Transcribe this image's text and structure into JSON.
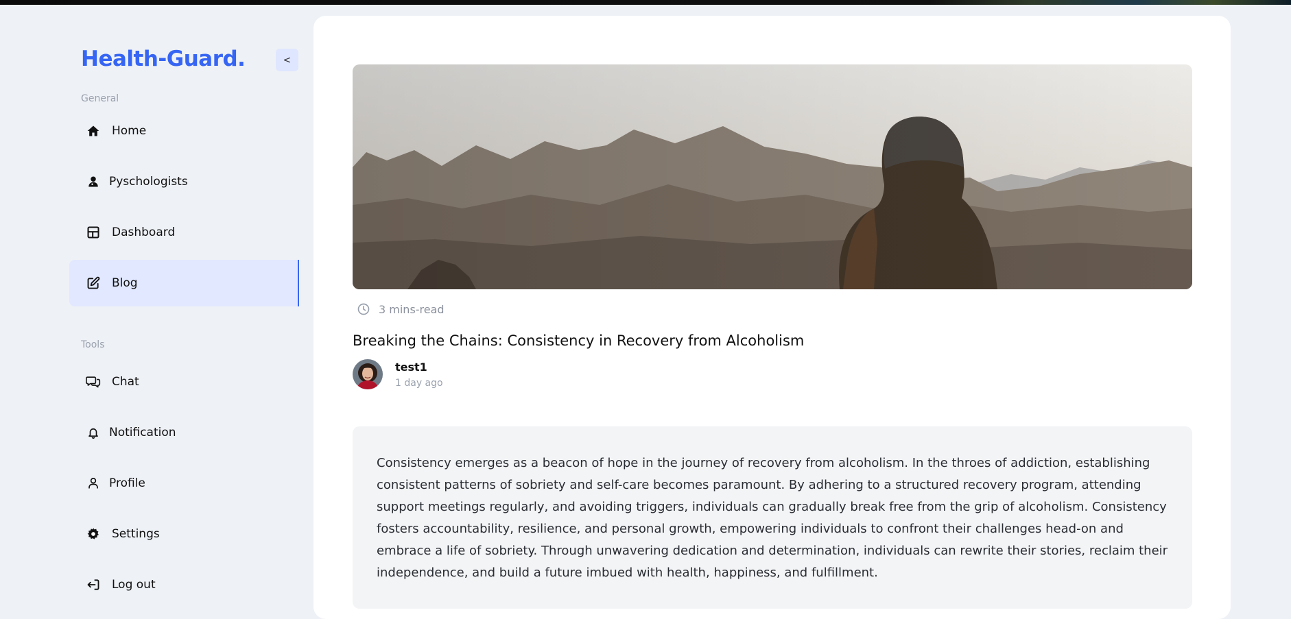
{
  "app": {
    "logo": "Health-Guard.",
    "collapse_label": "<"
  },
  "sidebar": {
    "general_label": "General",
    "tools_label": "Tools",
    "general_items": [
      {
        "label": "Home",
        "icon": "home-icon"
      },
      {
        "label": "Pyschologists",
        "icon": "psychologist-icon"
      },
      {
        "label": "Dashboard",
        "icon": "dashboard-icon"
      },
      {
        "label": "Blog",
        "icon": "edit-icon",
        "active": true
      }
    ],
    "tool_items": [
      {
        "label": "Chat",
        "icon": "chat-icon"
      },
      {
        "label": "Notification",
        "icon": "bell-icon"
      },
      {
        "label": "Profile",
        "icon": "user-icon"
      },
      {
        "label": "Settings",
        "icon": "gear-icon"
      },
      {
        "label": "Log out",
        "icon": "logout-icon"
      }
    ]
  },
  "post": {
    "read_time": "3 mins-read",
    "title": "Breaking the Chains: Consistency in Recovery from Alcoholism",
    "author": "test1",
    "posted": "1 day ago",
    "body": "Consistency emerges as a beacon of hope in the journey of recovery from alcoholism. In the throes of addiction, establishing consistent patterns of sobriety and self-care becomes paramount. By adhering to a structured recovery program, attending support meetings regularly, and avoiding triggers, individuals can gradually break free from the grip of alcoholism. Consistency fosters accountability, resilience, and personal growth, empowering individuals to confront their challenges head-on and embrace a life of sobriety. Through unwavering dedication and determination, individuals can rewrite their stories, reclaim their independence, and build a future imbued with health, happiness, and fulfillment."
  },
  "colors": {
    "accent": "#3665f3",
    "active_bg": "#e1e8ff",
    "page_bg": "#eef1f6"
  }
}
